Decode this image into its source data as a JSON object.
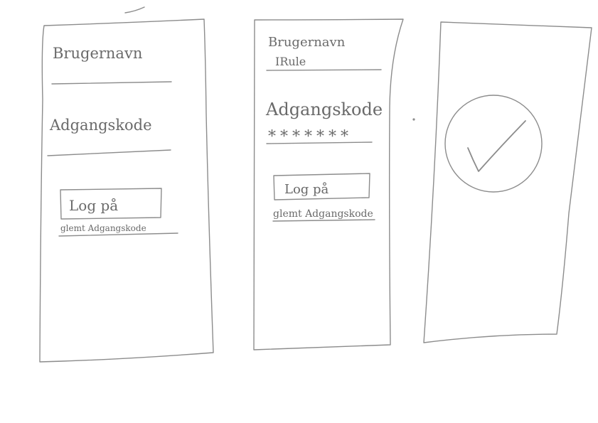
{
  "screens": [
    {
      "username_label": "Brugernavn",
      "password_label": "Adgangskode",
      "login_button_label": "Log på",
      "forgot_password_link": "glemt Adgangskode"
    },
    {
      "username_label": "Brugernavn",
      "username_value": "IRule",
      "password_label": "Adgangskode",
      "password_value": "*******",
      "login_button_label": "Log på",
      "forgot_password_link": "glemt Adgangskode"
    },
    {
      "success_icon": "checkmark-icon"
    }
  ],
  "colors": {
    "pencil": "#8c8c8c",
    "pencil_text": "#6a6a6a",
    "paper": "#ffffff"
  }
}
